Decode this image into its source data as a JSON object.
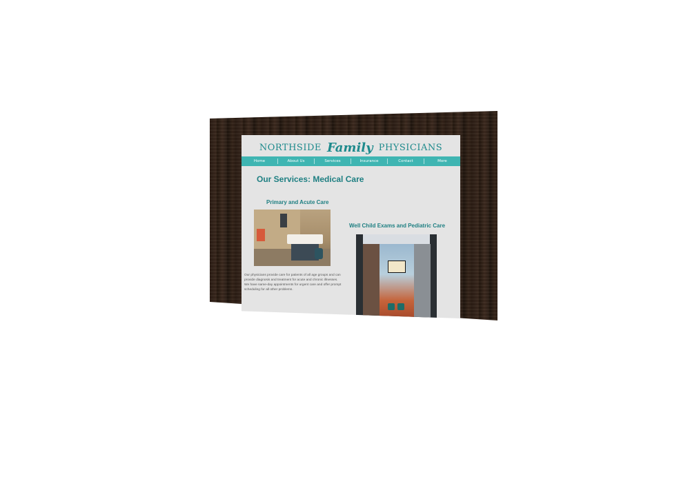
{
  "site": {
    "logo": {
      "word1": "NORTHSIDE",
      "word2": "Family",
      "word3": "PHYSICIANS"
    },
    "nav": {
      "items": [
        "Home",
        "About Us",
        "Services",
        "Insurance",
        "Contact",
        "More"
      ]
    },
    "page_title": "Our Services:  Medical Care",
    "sections": [
      {
        "title": "Primary and Acute Care",
        "image_alt": "exam-room-photo",
        "body": "Our physicians provide care for patients of all age groups and can provide diagnosis and treatment for acute and chronic illnesses.  We have same-day appointments for urgent care and offer prompt scheduling for all other problems."
      },
      {
        "title": "Well Child Exams and Pediatric Care",
        "image_alt": "hallway-photo"
      }
    ]
  },
  "colors": {
    "accent": "#3fb5b2",
    "heading": "#1e7f82",
    "canvas": "#e4e4e4",
    "frame": "#2f2118"
  }
}
